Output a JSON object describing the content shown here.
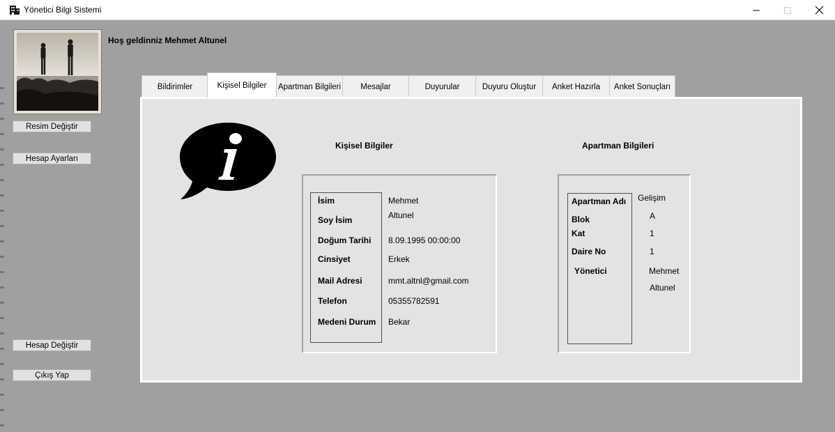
{
  "window": {
    "title": "Yönetici Bilgi Sistemi",
    "icon": "building-icon",
    "controls": {
      "minimize": "minimize-icon",
      "maximize": "maximize-icon",
      "close": "close-icon"
    }
  },
  "welcome_text": "Hoş geldinniz Mehmet Altunel",
  "sidebar": {
    "change_photo": "Resim Değiştir",
    "account_settings": "Hesap Ayarları",
    "switch_account": "Hesap Değiştir",
    "logout": "Çıkış Yap"
  },
  "tabs": [
    {
      "label": "Bildirimler",
      "active": false
    },
    {
      "label": "Kişisel Bilgiler",
      "active": true
    },
    {
      "label": "Apartman Bilgileri",
      "active": false
    },
    {
      "label": "Mesajlar",
      "active": false
    },
    {
      "label": "Duyurular",
      "active": false
    },
    {
      "label": "Duyuru Oluştur",
      "active": false
    },
    {
      "label": "Anket Hazırla",
      "active": false
    },
    {
      "label": "Anket Sonuçları",
      "active": false
    }
  ],
  "personal": {
    "title": "Kişisel Bilgiler",
    "labels": {
      "name": "İsim",
      "surname": "Soy İsim",
      "birth": "Doğum Tarihi",
      "gender": "Cinsiyet",
      "mail": "Mail Adresi",
      "phone": "Telefon",
      "marital": "Medeni Durum"
    },
    "values": {
      "name": "Mehmet",
      "surname": "Altunel",
      "birth": "8.09.1995 00:00:00",
      "gender": "Erkek",
      "mail": "mmt.altnl@gmail.com",
      "phone": "05355782591",
      "marital": "Bekar"
    }
  },
  "apartment": {
    "title": "Apartman Bilgileri",
    "labels": {
      "name": "Apartman Adı",
      "block": "Blok",
      "floor": "Kat",
      "door": "Daire No",
      "manager": "Yönetici"
    },
    "values": {
      "name": "Gelişim",
      "block": "A",
      "floor": "1",
      "door": "1",
      "manager_first": "Mehmet",
      "manager_last": "Altunel"
    }
  },
  "colors": {
    "client_bg": "#a0a0a0",
    "panel_bg": "#e3e3e3",
    "button_bg": "#e1e1e1"
  }
}
